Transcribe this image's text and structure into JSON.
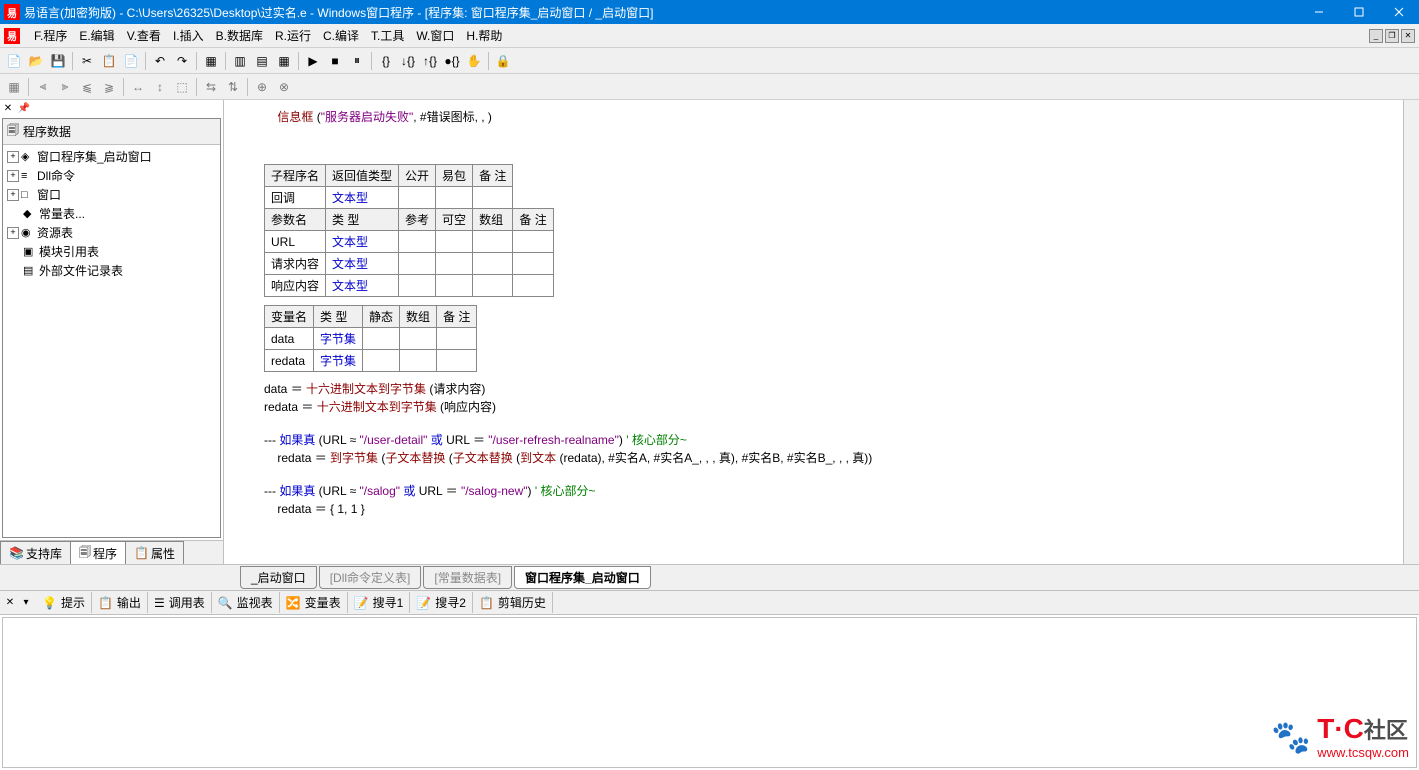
{
  "titlebar": {
    "text": "易语言(加密狗版) - C:\\Users\\26325\\Desktop\\过实名.e - Windows窗口程序 - [程序集: 窗口程序集_启动窗口 / _启动窗口]"
  },
  "menu": {
    "file": "F.程序",
    "edit": "E.编辑",
    "view": "V.查看",
    "insert": "I.插入",
    "database": "B.数据库",
    "run": "R.运行",
    "compile": "C.编译",
    "tools": "T.工具",
    "window": "W.窗口",
    "help": "H.帮助"
  },
  "tree": {
    "header": "程序数据",
    "items": [
      {
        "label": "窗口程序集_启动窗口",
        "icon": "◈",
        "expander": "+"
      },
      {
        "label": "Dll命令",
        "icon": "≡",
        "expander": "+"
      },
      {
        "label": "窗口",
        "icon": "□",
        "expander": "+"
      },
      {
        "label": "常量表...",
        "icon": "◆",
        "expander": ""
      },
      {
        "label": "资源表",
        "icon": "◉",
        "expander": "+"
      },
      {
        "label": "模块引用表",
        "icon": "▣",
        "expander": ""
      },
      {
        "label": "外部文件记录表",
        "icon": "▤",
        "expander": ""
      }
    ]
  },
  "left_tabs": {
    "support": "支持库",
    "program": "程序",
    "properties": "属性"
  },
  "code": {
    "line1_a": "信息框",
    "line1_b": " (",
    "line1_c": "\"服务器启动失败\"",
    "line1_d": ", ",
    "line1_e": "#错误图标",
    "line1_f": ", , )",
    "t1_headers": [
      "子程序名",
      "返回值类型",
      "公开",
      "易包",
      "备 注"
    ],
    "t1_row": [
      "回调",
      "文本型",
      "",
      "",
      ""
    ],
    "t2_headers": [
      "参数名",
      "类 型",
      "参考",
      "可空",
      "数组",
      "备 注"
    ],
    "t2_rows": [
      [
        "URL",
        "文本型",
        "",
        "",
        "",
        ""
      ],
      [
        "请求内容",
        "文本型",
        "",
        "",
        "",
        ""
      ],
      [
        "响应内容",
        "文本型",
        "",
        "",
        "",
        ""
      ]
    ],
    "t3_headers": [
      "变量名",
      "类 型",
      "静态",
      "数组",
      "备 注"
    ],
    "t3_rows": [
      [
        "data",
        "字节集",
        "",
        "",
        ""
      ],
      [
        "redata",
        "字节集",
        "",
        "",
        ""
      ]
    ],
    "line2_a": "data ＝ ",
    "line2_b": "十六进制文本到字节集",
    "line2_c": " (请求内容)",
    "line3_a": "redata ＝ ",
    "line3_b": "十六进制文本到字节集",
    "line3_c": " (响应内容)",
    "line4_pre": "--- ",
    "line4_a": "如果真",
    "line4_b": " (URL ≈ ",
    "line4_c": "\"/user-detail\"",
    "line4_d": " 或 ",
    "line4_e": "URL ＝ ",
    "line4_f": "\"/user-refresh-realname\"",
    "line4_g": ") ",
    "line4_h": "' 核心部分~",
    "line5_a": "redata ＝ ",
    "line5_b": "到字节集",
    "line5_c": " (",
    "line5_d": "子文本替换",
    "line5_e": " (",
    "line5_f": "子文本替换",
    "line5_g": " (",
    "line5_h": "到文本",
    "line5_i": " (redata), ",
    "line5_j": "#实名A",
    "line5_k": ", ",
    "line5_l": "#实名A_",
    "line5_m": ", , , 真), ",
    "line5_n": "#实名B",
    "line5_o": ", ",
    "line5_p": "#实名B_",
    "line5_q": ", , , 真))",
    "line6_pre": "--- ",
    "line6_a": "如果真",
    "line6_b": " (URL ≈ ",
    "line6_c": "\"/salog\"",
    "line6_d": " 或 ",
    "line6_e": "URL ＝ ",
    "line6_f": "\"/salog-new\"",
    "line6_g": ") ",
    "line6_h": "' 核心部分~",
    "line7_a": "redata ＝ { 1, 1 }"
  },
  "bottom_tabs": {
    "t1": "_启动窗口",
    "t2": "[Dll命令定义表]",
    "t3": "[常量数据表]",
    "t4": "窗口程序集_启动窗口"
  },
  "output_tabs": {
    "hint": "提示",
    "output": "输出",
    "debug": "调用表",
    "watch": "监视表",
    "vars": "变量表",
    "search1": "搜寻1",
    "search2": "搜寻2",
    "clip": "剪辑历史"
  },
  "watermark": {
    "logo": "T·C",
    "cn": "社区",
    "url": "www.tcsqw.com"
  }
}
